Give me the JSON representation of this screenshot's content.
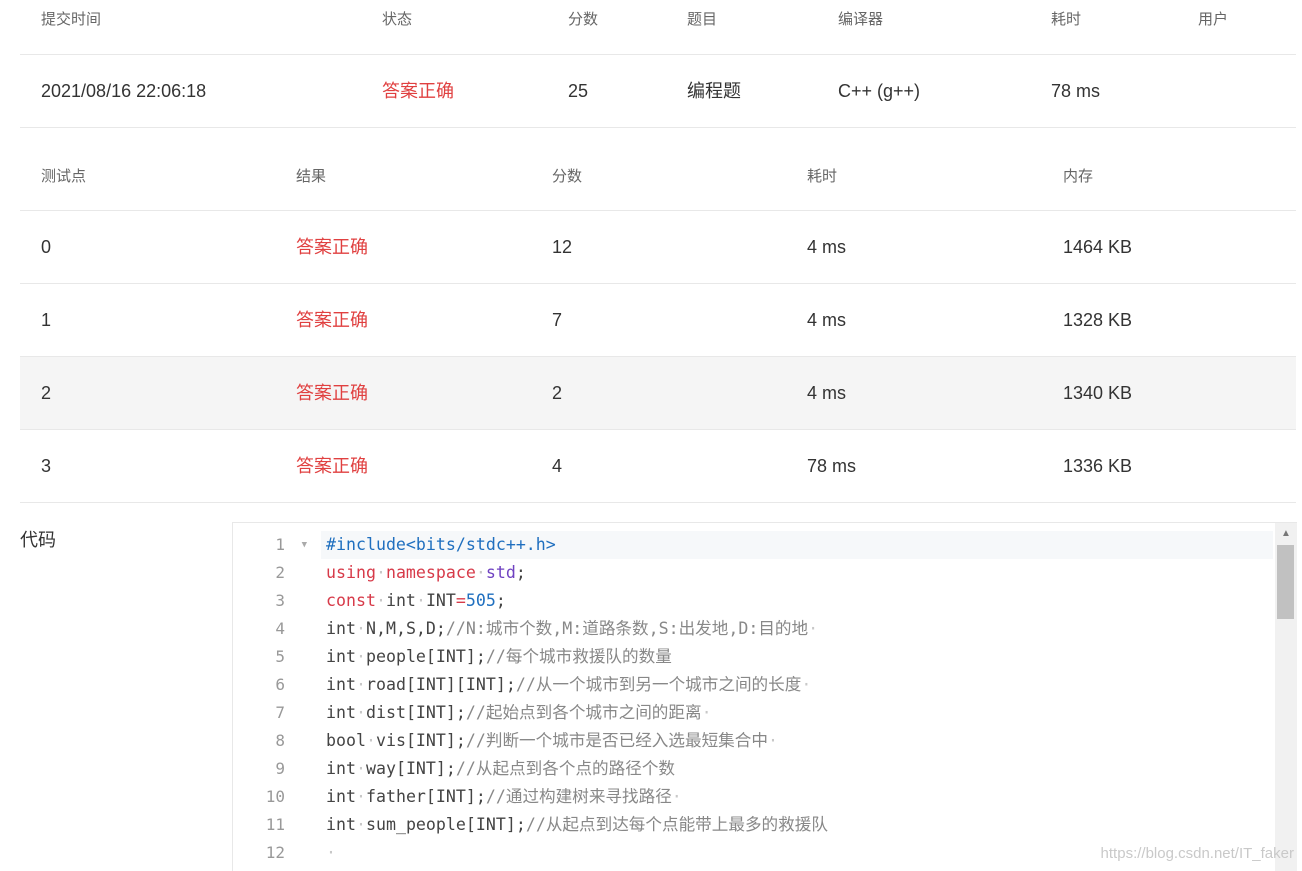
{
  "submission": {
    "headers": [
      "提交时间",
      "状态",
      "分数",
      "题目",
      "编译器",
      "耗时",
      "用户"
    ],
    "row": {
      "time": "2021/08/16 22:06:18",
      "status": "答案正确",
      "score": "25",
      "problem": "编程题",
      "compiler": "C++ (g++)",
      "duration": "78 ms",
      "user": ""
    }
  },
  "testcases": {
    "headers": [
      "测试点",
      "结果",
      "分数",
      "耗时",
      "内存"
    ],
    "rows": [
      {
        "id": "0",
        "result": "答案正确",
        "score": "12",
        "time": "4 ms",
        "memory": "1464 KB"
      },
      {
        "id": "1",
        "result": "答案正确",
        "score": "7",
        "time": "4 ms",
        "memory": "1328 KB"
      },
      {
        "id": "2",
        "result": "答案正确",
        "score": "2",
        "time": "4 ms",
        "memory": "1340 KB"
      },
      {
        "id": "3",
        "result": "答案正确",
        "score": "4",
        "time": "78 ms",
        "memory": "1336 KB"
      }
    ]
  },
  "code": {
    "label": "代码",
    "line_numbers": [
      "1",
      "2",
      "3",
      "4",
      "5",
      "6",
      "7",
      "8",
      "9",
      "10",
      "11",
      "12"
    ],
    "lines": [
      [
        {
          "t": "pre",
          "v": "#include<bits/stdc++.h>"
        }
      ],
      [
        {
          "t": "kw",
          "v": "using"
        },
        {
          "t": "dot",
          "v": "·"
        },
        {
          "t": "kw",
          "v": "namespace"
        },
        {
          "t": "dot",
          "v": "·"
        },
        {
          "t": "ns",
          "v": "std"
        },
        {
          "t": "plain",
          "v": ";"
        }
      ],
      [
        {
          "t": "kw",
          "v": "const"
        },
        {
          "t": "dot",
          "v": "·"
        },
        {
          "t": "plain",
          "v": "int"
        },
        {
          "t": "dot",
          "v": "·"
        },
        {
          "t": "plain",
          "v": "INT"
        },
        {
          "t": "op",
          "v": "="
        },
        {
          "t": "num",
          "v": "505"
        },
        {
          "t": "plain",
          "v": ";"
        }
      ],
      [
        {
          "t": "plain",
          "v": "int"
        },
        {
          "t": "dot",
          "v": "·"
        },
        {
          "t": "plain",
          "v": "N,M,S,D;"
        },
        {
          "t": "cmt",
          "v": "//N:城市个数,M:道路条数,S:出发地,D:目的地"
        },
        {
          "t": "dot",
          "v": "·"
        }
      ],
      [
        {
          "t": "plain",
          "v": "int"
        },
        {
          "t": "dot",
          "v": "·"
        },
        {
          "t": "plain",
          "v": "people[INT];"
        },
        {
          "t": "cmt",
          "v": "//每个城市救援队的数量"
        }
      ],
      [
        {
          "t": "plain",
          "v": "int"
        },
        {
          "t": "dot",
          "v": "·"
        },
        {
          "t": "plain",
          "v": "road[INT][INT];"
        },
        {
          "t": "cmt",
          "v": "//从一个城市到另一个城市之间的长度"
        },
        {
          "t": "dot",
          "v": "·"
        }
      ],
      [
        {
          "t": "plain",
          "v": "int"
        },
        {
          "t": "dot",
          "v": "·"
        },
        {
          "t": "plain",
          "v": "dist[INT];"
        },
        {
          "t": "cmt",
          "v": "//起始点到各个城市之间的距离"
        },
        {
          "t": "dot",
          "v": "·"
        }
      ],
      [
        {
          "t": "plain",
          "v": "bool"
        },
        {
          "t": "dot",
          "v": "·"
        },
        {
          "t": "plain",
          "v": "vis[INT];"
        },
        {
          "t": "cmt",
          "v": "//判断一个城市是否已经入选最短集合中"
        },
        {
          "t": "dot",
          "v": "·"
        }
      ],
      [
        {
          "t": "plain",
          "v": "int"
        },
        {
          "t": "dot",
          "v": "·"
        },
        {
          "t": "plain",
          "v": "way[INT];"
        },
        {
          "t": "cmt",
          "v": "//从起点到各个点的路径个数"
        }
      ],
      [
        {
          "t": "plain",
          "v": "int"
        },
        {
          "t": "dot",
          "v": "·"
        },
        {
          "t": "plain",
          "v": "father[INT];"
        },
        {
          "t": "cmt",
          "v": "//通过构建树来寻找路径"
        },
        {
          "t": "dot",
          "v": "·"
        }
      ],
      [
        {
          "t": "plain",
          "v": "int"
        },
        {
          "t": "dot",
          "v": "·"
        },
        {
          "t": "plain",
          "v": "sum_people[INT];"
        },
        {
          "t": "cmt",
          "v": "//从起点到达每个点能带上最多的救援队"
        }
      ],
      [
        {
          "t": "dot",
          "v": "·"
        }
      ]
    ]
  },
  "colors": {
    "accepted": "#e04040",
    "row_alt_bg": "#f5f5f5",
    "keyword": "#d73a49",
    "preprocessor": "#1f6fbf",
    "comment": "#888888"
  },
  "watermark": "https://blog.csdn.net/IT_faker"
}
